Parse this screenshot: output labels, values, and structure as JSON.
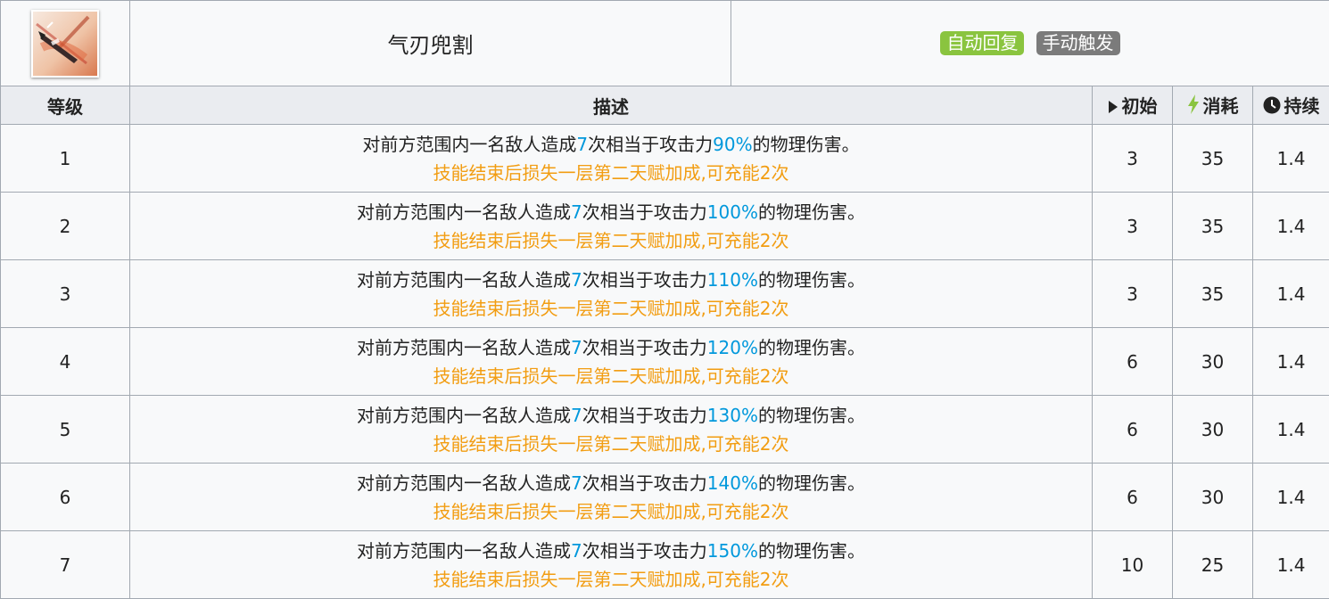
{
  "skill": {
    "name": "气刃兜割",
    "badges": [
      "自动回复",
      "手动触发"
    ]
  },
  "columns": {
    "level": "等级",
    "description": "描述",
    "initial": "初始",
    "cost": "消耗",
    "duration": "持续"
  },
  "rows": [
    {
      "level": "1",
      "d1_pre": "对前方范围内一名敌人造成",
      "d1_hits": "7",
      "d1_mid": "次相当于攻击力",
      "d1_pct": "90%",
      "d1_post": "的物理伤害。",
      "d2": "技能结束后损失一层第二天赋加成,可充能2次",
      "initial": "3",
      "cost": "35",
      "duration": "1.4"
    },
    {
      "level": "2",
      "d1_pre": "对前方范围内一名敌人造成",
      "d1_hits": "7",
      "d1_mid": "次相当于攻击力",
      "d1_pct": "100%",
      "d1_post": "的物理伤害。",
      "d2": "技能结束后损失一层第二天赋加成,可充能2次",
      "initial": "3",
      "cost": "35",
      "duration": "1.4"
    },
    {
      "level": "3",
      "d1_pre": "对前方范围内一名敌人造成",
      "d1_hits": "7",
      "d1_mid": "次相当于攻击力",
      "d1_pct": "110%",
      "d1_post": "的物理伤害。",
      "d2": "技能结束后损失一层第二天赋加成,可充能2次",
      "initial": "3",
      "cost": "35",
      "duration": "1.4"
    },
    {
      "level": "4",
      "d1_pre": "对前方范围内一名敌人造成",
      "d1_hits": "7",
      "d1_mid": "次相当于攻击力",
      "d1_pct": "120%",
      "d1_post": "的物理伤害。",
      "d2": "技能结束后损失一层第二天赋加成,可充能2次",
      "initial": "6",
      "cost": "30",
      "duration": "1.4"
    },
    {
      "level": "5",
      "d1_pre": "对前方范围内一名敌人造成",
      "d1_hits": "7",
      "d1_mid": "次相当于攻击力",
      "d1_pct": "130%",
      "d1_post": "的物理伤害。",
      "d2": "技能结束后损失一层第二天赋加成,可充能2次",
      "initial": "6",
      "cost": "30",
      "duration": "1.4"
    },
    {
      "level": "6",
      "d1_pre": "对前方范围内一名敌人造成",
      "d1_hits": "7",
      "d1_mid": "次相当于攻击力",
      "d1_pct": "140%",
      "d1_post": "的物理伤害。",
      "d2": "技能结束后损失一层第二天赋加成,可充能2次",
      "initial": "6",
      "cost": "30",
      "duration": "1.4"
    },
    {
      "level": "7",
      "d1_pre": "对前方范围内一名敌人造成",
      "d1_hits": "7",
      "d1_mid": "次相当于攻击力",
      "d1_pct": "150%",
      "d1_post": "的物理伤害。",
      "d2": "技能结束后损失一层第二天赋加成,可充能2次",
      "initial": "10",
      "cost": "25",
      "duration": "1.4"
    }
  ],
  "colors": {
    "auto_recover_badge": "#8ac43f",
    "manual_trigger_badge": "#7b7b7b",
    "highlight_blue": "#0098dc",
    "note_orange": "#f29d12"
  },
  "icons": {
    "skill": "blade-skill-icon",
    "initial": "play-triangle-icon",
    "cost": "lightning-icon",
    "duration": "clock-icon"
  }
}
